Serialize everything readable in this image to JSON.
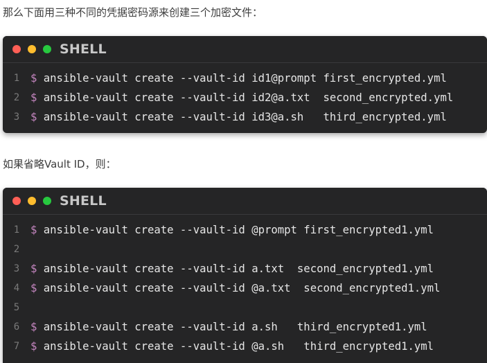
{
  "intro_text": "那么下面用三种不同的凭据密码源来创建三个加密文件：",
  "middle_text": "如果省略Vault ID，则：",
  "blocks": [
    {
      "lang": "SHELL",
      "lines": [
        {
          "num": "1",
          "prompt": "$",
          "code": " ansible-vault create --vault-id id1@prompt first_encrypted.yml"
        },
        {
          "num": "2",
          "prompt": "$",
          "code": " ansible-vault create --vault-id id2@a.txt  second_encrypted.yml"
        },
        {
          "num": "3",
          "prompt": "$",
          "code": " ansible-vault create --vault-id id3@a.sh   third_encrypted.yml"
        }
      ]
    },
    {
      "lang": "SHELL",
      "lines": [
        {
          "num": "1",
          "prompt": "$",
          "code": " ansible-vault create --vault-id @prompt first_encrypted1.yml"
        },
        {
          "num": "2",
          "prompt": "",
          "code": ""
        },
        {
          "num": "3",
          "prompt": "$",
          "code": " ansible-vault create --vault-id a.txt  second_encrypted1.yml"
        },
        {
          "num": "4",
          "prompt": "$",
          "code": " ansible-vault create --vault-id @a.txt  second_encrypted1.yml"
        },
        {
          "num": "5",
          "prompt": "",
          "code": ""
        },
        {
          "num": "6",
          "prompt": "$",
          "code": " ansible-vault create --vault-id a.sh   third_encrypted1.yml"
        },
        {
          "num": "7",
          "prompt": "$",
          "code": " ansible-vault create --vault-id @a.sh   third_encrypted1.yml"
        }
      ]
    }
  ],
  "window_dots": [
    "#ff5f56",
    "#ffbd2e",
    "#27c93f"
  ]
}
